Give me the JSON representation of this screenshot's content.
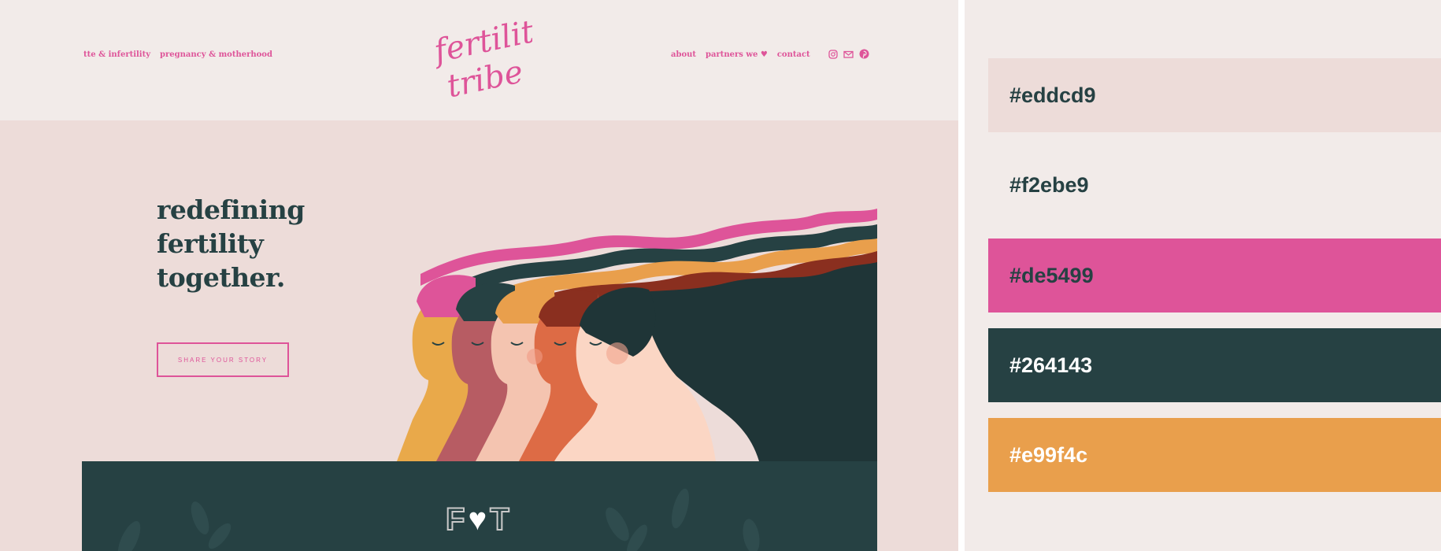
{
  "header": {
    "nav_left": [
      "tte & infertility",
      "pregnancy & motherhood"
    ],
    "logo_text": [
      "fertility",
      "tribe"
    ],
    "nav_right": [
      "about",
      "partners we",
      "contact"
    ],
    "partners_heart": "♥",
    "social_icons": [
      "instagram-icon",
      "mail-icon",
      "pinterest-icon"
    ]
  },
  "hero": {
    "heading_lines": [
      "redefining",
      "fertility",
      "together."
    ],
    "cta_label": "SHARE YOUR STORY"
  },
  "band": {
    "logo_left": "F",
    "logo_heart": "♥",
    "logo_right": "T"
  },
  "palette": {
    "swatches": [
      {
        "hex": "#eddcd9",
        "label": "#eddcd9",
        "text_color": "#264143"
      },
      {
        "hex": "#f2ebe9",
        "label": "#f2ebe9",
        "text_color": "#264143"
      },
      {
        "hex": "#de5499",
        "label": "#de5499",
        "text_color": "#264143"
      },
      {
        "hex": "#264143",
        "label": "#264143",
        "text_color": "#ffffff"
      },
      {
        "hex": "#e99f4c",
        "label": "#e99f4c",
        "text_color": "#ffffff"
      }
    ]
  },
  "colors": {
    "pink": "#de5499",
    "dark_teal": "#264143",
    "orange": "#e99f4c",
    "blush": "#eddcd9",
    "light": "#f2ebe9"
  }
}
